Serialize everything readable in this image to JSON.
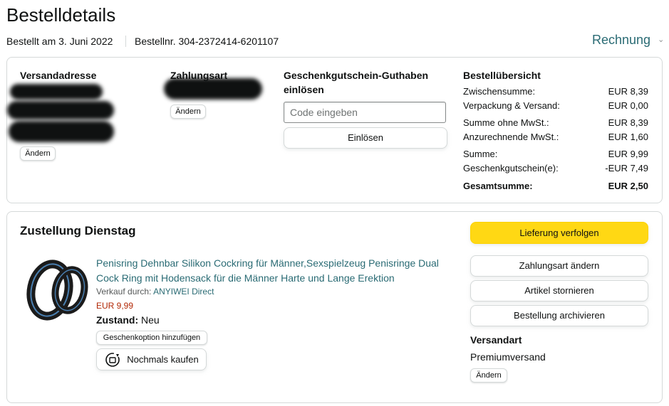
{
  "page": {
    "title": "Bestelldetails",
    "ordered_date": "Bestellt am 3. Juni 2022",
    "order_number": "Bestellnr. 304-2372414-6201107",
    "invoice_label": "Rechnung"
  },
  "summary_box": {
    "shipping_address": {
      "title": "Versandadresse",
      "change_label": "Ändern"
    },
    "payment": {
      "title": "Zahlungsart",
      "change_label": "Ändern"
    },
    "gift_card": {
      "title_line1": "Geschenkgutschein-Guthaben",
      "title_line2": "einlösen",
      "placeholder": "Code eingeben",
      "redeem_label": "Einlösen"
    },
    "order_summary": {
      "title": "Bestellübersicht",
      "rows": [
        {
          "label": "Zwischensumme:",
          "value": "EUR 8,39"
        },
        {
          "label": "Verpackung & Versand:",
          "value": "EUR 0,00"
        },
        {
          "label": "Summe ohne MwSt.:",
          "value": "EUR 8,39"
        },
        {
          "label": "Anzurechnende MwSt.:",
          "value": "EUR 1,60"
        },
        {
          "label": "Summe:",
          "value": "EUR 9,99"
        },
        {
          "label": "Geschenkgutschein(e):",
          "value": "-EUR 7,49"
        },
        {
          "label": "Gesamtsumme:",
          "value": "EUR 2,50"
        }
      ]
    }
  },
  "delivery": {
    "heading": "Zustellung Dienstag",
    "product": {
      "title_line1": "Penisring Dehnbar Silikon Cockring für Männer,Sexspielzeug Penisringe Dual",
      "title_line2": "Cock Ring mit Hodensack für die Männer Harte und Lange Erektion",
      "sold_by_prefix": "Verkauf durch: ",
      "seller": "ANYIWEI Direct",
      "price": "EUR 9,99",
      "condition_label": "Zustand:",
      "condition_value": "Neu",
      "gift_option_label": "Geschenkoption hinzufügen",
      "buy_again_label": "Nochmals kaufen"
    },
    "actions": {
      "track": "Lieferung verfolgen",
      "change_payment": "Zahlungsart ändern",
      "cancel": "Artikel stornieren",
      "archive": "Bestellung archivieren"
    },
    "shipping_method": {
      "title": "Versandart",
      "value": "Premiumversand",
      "change_label": "Ändern"
    }
  },
  "colors": {
    "accent_link": "#2a6b74",
    "price": "#b12704",
    "primary_button": "#ffd814"
  }
}
